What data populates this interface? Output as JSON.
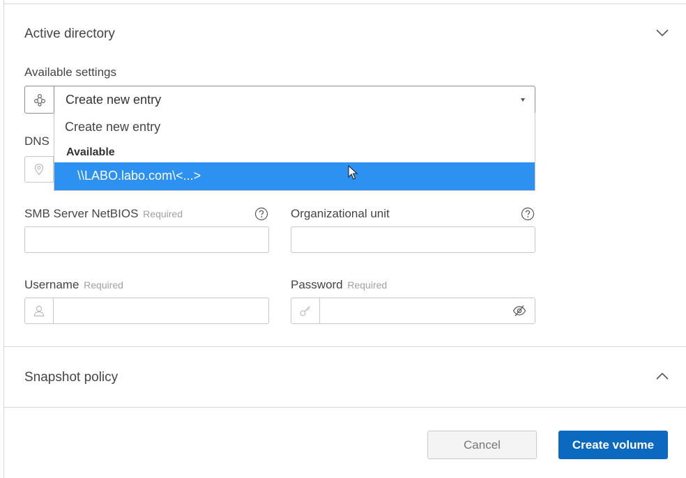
{
  "active_directory": {
    "title": "Active directory",
    "available_settings_label": "Available settings",
    "select_value": "Create new entry",
    "dropdown": {
      "option_create": "Create new entry",
      "group_label": "Available",
      "selected_option": "\\\\LABO.labo.com\\<...>"
    },
    "dns_label": "DNS",
    "smb_label": "SMB Server NetBIOS",
    "smb_required": "Required",
    "smb_value": "",
    "ou_label": "Organizational unit",
    "ou_value": "",
    "username_label": "Username",
    "username_required": "Required",
    "username_value": "",
    "password_label": "Password",
    "password_required": "Required",
    "password_value": ""
  },
  "snapshot_policy": {
    "title": "Snapshot policy"
  },
  "footer": {
    "cancel_label": "Cancel",
    "create_label": "Create volume"
  },
  "colors": {
    "primary": "#0b6abf",
    "selection": "#2c91f0",
    "border": "#c6c6c6"
  },
  "icons": {
    "section_toggle": "chevron-down-icon",
    "snapshot_toggle": "chevron-up-icon",
    "select_prefix": "network-icon",
    "dns_prefix": "location-pin-icon",
    "username_prefix": "user-icon",
    "password_prefix": "key-icon",
    "password_toggle": "eye-slash-icon",
    "help": "question-circle-icon"
  }
}
